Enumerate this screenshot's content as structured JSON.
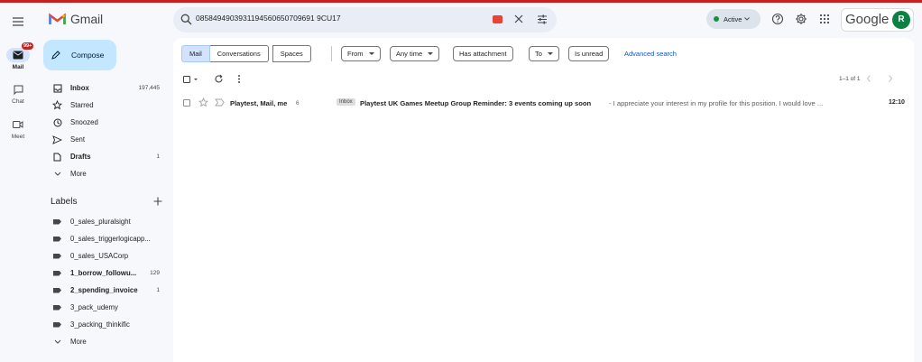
{
  "app": {
    "name": "Gmail"
  },
  "rail": {
    "items": [
      {
        "label": "Mail",
        "badge": "99+",
        "icon": "mail-icon"
      },
      {
        "label": "Chat",
        "icon": "chat-icon"
      },
      {
        "label": "Meet",
        "icon": "video-icon"
      }
    ]
  },
  "search": {
    "value": "0858494903931194560650709691 9CU17"
  },
  "status": {
    "label": "Active"
  },
  "account": {
    "brand": "Google",
    "initial": "R"
  },
  "compose": {
    "label": "Compose"
  },
  "nav": [
    {
      "label": "Inbox",
      "count": "197,445",
      "bold": true,
      "icon": "inbox-icon"
    },
    {
      "label": "Starred",
      "count": "",
      "icon": "star-icon"
    },
    {
      "label": "Snoozed",
      "count": "",
      "icon": "clock-icon"
    },
    {
      "label": "Sent",
      "count": "",
      "icon": "send-icon"
    },
    {
      "label": "Drafts",
      "count": "1",
      "bold": true,
      "icon": "draft-icon"
    },
    {
      "label": "More",
      "count": "",
      "icon": "chevron-down-icon"
    }
  ],
  "labels": {
    "title": "Labels",
    "items": [
      {
        "label": "0_sales_pluralsight",
        "count": ""
      },
      {
        "label": "0_sales_triggerlogicapp...",
        "count": ""
      },
      {
        "label": "0_sales_USACorp",
        "count": ""
      },
      {
        "label": "1_borrow_followu...",
        "count": "129",
        "bold": true
      },
      {
        "label": "2_spending_invoice",
        "count": "1",
        "bold": true
      },
      {
        "label": "3_pack_udemy",
        "count": ""
      },
      {
        "label": "3_packing_thinkific",
        "count": ""
      }
    ],
    "more": "More"
  },
  "tabs": [
    "Mail",
    "Conversations",
    "Spaces"
  ],
  "filters": {
    "from": "From",
    "any_time": "Any time",
    "has_attachment": "Has attachment",
    "to": "To",
    "is_unread": "Is unread",
    "advanced": "Advanced search"
  },
  "pager": {
    "text": "1–1 of 1"
  },
  "emails": [
    {
      "sender": "Playtest, Mail, me",
      "count": "6",
      "label": "Inbox",
      "subject": "Playtest UK Games Meetup Group Reminder: 3 events coming up soon",
      "snippet": " - I appreciate your interest in my profile for this position. I would love ...",
      "time": "12:10"
    }
  ]
}
